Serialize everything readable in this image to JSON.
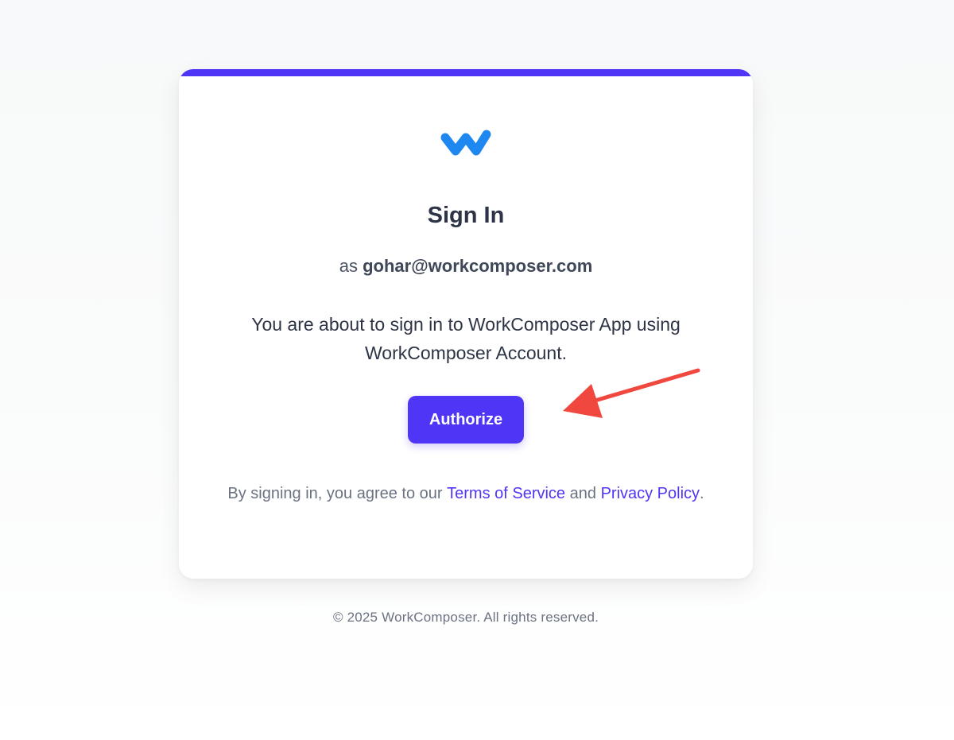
{
  "card": {
    "title": "Sign In",
    "account_prefix": "as",
    "account_email": "gohar@workcomposer.com",
    "message": "You are about to sign in to WorkComposer App using WorkComposer Account.",
    "authorize_label": "Authorize",
    "legal": {
      "prefix": "By signing in, you agree to our",
      "terms_label": "Terms of Service",
      "conjunction": "and",
      "privacy_label": "Privacy Policy",
      "suffix": "."
    }
  },
  "footer": {
    "copyright": "© 2025 WorkComposer. All rights reserved."
  },
  "logo": {
    "icon": "workcomposer-w-logo",
    "color": "#1e88f0"
  },
  "annotation": {
    "icon": "red-arrow-pointing-to-authorize",
    "color": "#f0483e"
  },
  "colors": {
    "accent": "#4f35f5",
    "text": "#2d3446",
    "muted": "#6b7282"
  }
}
